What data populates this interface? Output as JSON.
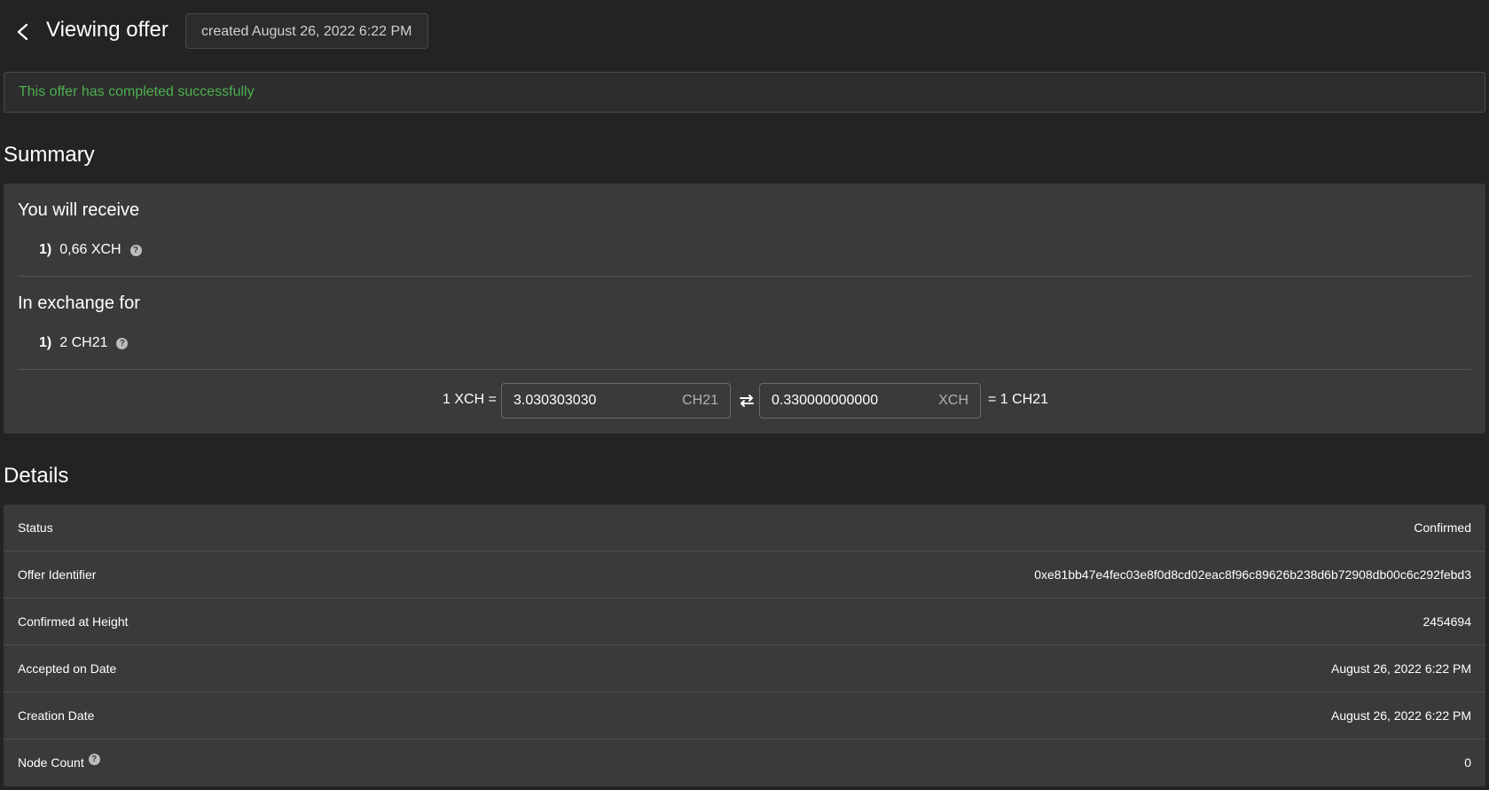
{
  "header": {
    "title": "Viewing offer",
    "created_chip": "created August 26, 2022 6:22 PM"
  },
  "banner": {
    "message": "This offer has completed successfully"
  },
  "summary": {
    "heading": "Summary",
    "receive_title": "You will receive",
    "receive_items": [
      {
        "index": "1)",
        "text": "0,66 XCH"
      }
    ],
    "exchange_title": "In exchange for",
    "exchange_items": [
      {
        "index": "1)",
        "text": "2 CH21"
      }
    ],
    "rate": {
      "left_prefix": "1 XCH =",
      "field1_value": "3.030303030",
      "field1_unit": "CH21",
      "field2_value": "0.330000000000",
      "field2_unit": "XCH",
      "right_suffix": "= 1 CH21"
    }
  },
  "details": {
    "heading": "Details",
    "rows": [
      {
        "label": "Status",
        "value": "Confirmed"
      },
      {
        "label": "Offer Identifier",
        "value": "0xe81bb47e4fec03e8f0d8cd02eac8f96c89626b238d6b72908db00c6c292febd3"
      },
      {
        "label": "Confirmed at Height",
        "value": "2454694"
      },
      {
        "label": "Accepted on Date",
        "value": "August 26, 2022 6:22 PM"
      },
      {
        "label": "Creation Date",
        "value": "August 26, 2022 6:22 PM"
      },
      {
        "label": "Node Count",
        "value": "0"
      }
    ]
  },
  "icons": {
    "back": "chevron-left-icon",
    "help": "help-circle-icon",
    "swap": "swap-horizontal-icon"
  },
  "colors": {
    "background": "#232323",
    "card": "#3a3a3a",
    "success": "#4caf50"
  }
}
